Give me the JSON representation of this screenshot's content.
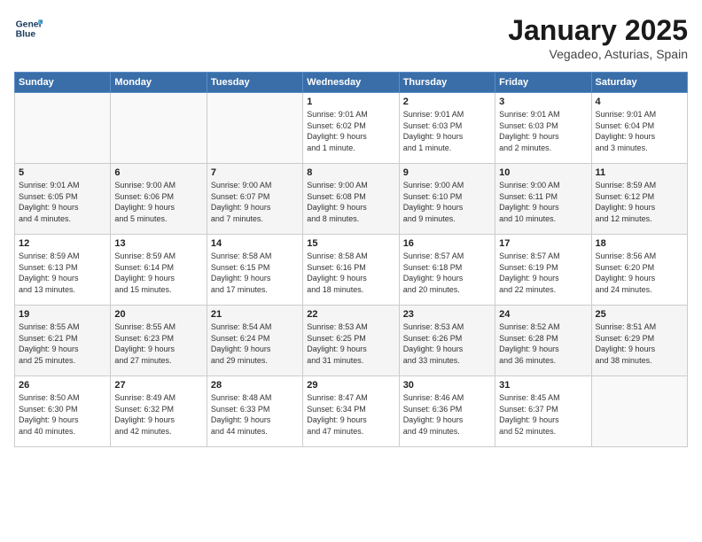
{
  "header": {
    "logo_line1": "General",
    "logo_line2": "Blue",
    "title": "January 2025",
    "subtitle": "Vegadeo, Asturias, Spain"
  },
  "days_of_week": [
    "Sunday",
    "Monday",
    "Tuesday",
    "Wednesday",
    "Thursday",
    "Friday",
    "Saturday"
  ],
  "weeks": [
    [
      {
        "day": "",
        "content": ""
      },
      {
        "day": "",
        "content": ""
      },
      {
        "day": "",
        "content": ""
      },
      {
        "day": "1",
        "content": "Sunrise: 9:01 AM\nSunset: 6:02 PM\nDaylight: 9 hours\nand 1 minute."
      },
      {
        "day": "2",
        "content": "Sunrise: 9:01 AM\nSunset: 6:03 PM\nDaylight: 9 hours\nand 1 minute."
      },
      {
        "day": "3",
        "content": "Sunrise: 9:01 AM\nSunset: 6:03 PM\nDaylight: 9 hours\nand 2 minutes."
      },
      {
        "day": "4",
        "content": "Sunrise: 9:01 AM\nSunset: 6:04 PM\nDaylight: 9 hours\nand 3 minutes."
      }
    ],
    [
      {
        "day": "5",
        "content": "Sunrise: 9:01 AM\nSunset: 6:05 PM\nDaylight: 9 hours\nand 4 minutes."
      },
      {
        "day": "6",
        "content": "Sunrise: 9:00 AM\nSunset: 6:06 PM\nDaylight: 9 hours\nand 5 minutes."
      },
      {
        "day": "7",
        "content": "Sunrise: 9:00 AM\nSunset: 6:07 PM\nDaylight: 9 hours\nand 7 minutes."
      },
      {
        "day": "8",
        "content": "Sunrise: 9:00 AM\nSunset: 6:08 PM\nDaylight: 9 hours\nand 8 minutes."
      },
      {
        "day": "9",
        "content": "Sunrise: 9:00 AM\nSunset: 6:10 PM\nDaylight: 9 hours\nand 9 minutes."
      },
      {
        "day": "10",
        "content": "Sunrise: 9:00 AM\nSunset: 6:11 PM\nDaylight: 9 hours\nand 10 minutes."
      },
      {
        "day": "11",
        "content": "Sunrise: 8:59 AM\nSunset: 6:12 PM\nDaylight: 9 hours\nand 12 minutes."
      }
    ],
    [
      {
        "day": "12",
        "content": "Sunrise: 8:59 AM\nSunset: 6:13 PM\nDaylight: 9 hours\nand 13 minutes."
      },
      {
        "day": "13",
        "content": "Sunrise: 8:59 AM\nSunset: 6:14 PM\nDaylight: 9 hours\nand 15 minutes."
      },
      {
        "day": "14",
        "content": "Sunrise: 8:58 AM\nSunset: 6:15 PM\nDaylight: 9 hours\nand 17 minutes."
      },
      {
        "day": "15",
        "content": "Sunrise: 8:58 AM\nSunset: 6:16 PM\nDaylight: 9 hours\nand 18 minutes."
      },
      {
        "day": "16",
        "content": "Sunrise: 8:57 AM\nSunset: 6:18 PM\nDaylight: 9 hours\nand 20 minutes."
      },
      {
        "day": "17",
        "content": "Sunrise: 8:57 AM\nSunset: 6:19 PM\nDaylight: 9 hours\nand 22 minutes."
      },
      {
        "day": "18",
        "content": "Sunrise: 8:56 AM\nSunset: 6:20 PM\nDaylight: 9 hours\nand 24 minutes."
      }
    ],
    [
      {
        "day": "19",
        "content": "Sunrise: 8:55 AM\nSunset: 6:21 PM\nDaylight: 9 hours\nand 25 minutes."
      },
      {
        "day": "20",
        "content": "Sunrise: 8:55 AM\nSunset: 6:23 PM\nDaylight: 9 hours\nand 27 minutes."
      },
      {
        "day": "21",
        "content": "Sunrise: 8:54 AM\nSunset: 6:24 PM\nDaylight: 9 hours\nand 29 minutes."
      },
      {
        "day": "22",
        "content": "Sunrise: 8:53 AM\nSunset: 6:25 PM\nDaylight: 9 hours\nand 31 minutes."
      },
      {
        "day": "23",
        "content": "Sunrise: 8:53 AM\nSunset: 6:26 PM\nDaylight: 9 hours\nand 33 minutes."
      },
      {
        "day": "24",
        "content": "Sunrise: 8:52 AM\nSunset: 6:28 PM\nDaylight: 9 hours\nand 36 minutes."
      },
      {
        "day": "25",
        "content": "Sunrise: 8:51 AM\nSunset: 6:29 PM\nDaylight: 9 hours\nand 38 minutes."
      }
    ],
    [
      {
        "day": "26",
        "content": "Sunrise: 8:50 AM\nSunset: 6:30 PM\nDaylight: 9 hours\nand 40 minutes."
      },
      {
        "day": "27",
        "content": "Sunrise: 8:49 AM\nSunset: 6:32 PM\nDaylight: 9 hours\nand 42 minutes."
      },
      {
        "day": "28",
        "content": "Sunrise: 8:48 AM\nSunset: 6:33 PM\nDaylight: 9 hours\nand 44 minutes."
      },
      {
        "day": "29",
        "content": "Sunrise: 8:47 AM\nSunset: 6:34 PM\nDaylight: 9 hours\nand 47 minutes."
      },
      {
        "day": "30",
        "content": "Sunrise: 8:46 AM\nSunset: 6:36 PM\nDaylight: 9 hours\nand 49 minutes."
      },
      {
        "day": "31",
        "content": "Sunrise: 8:45 AM\nSunset: 6:37 PM\nDaylight: 9 hours\nand 52 minutes."
      },
      {
        "day": "",
        "content": ""
      }
    ]
  ]
}
